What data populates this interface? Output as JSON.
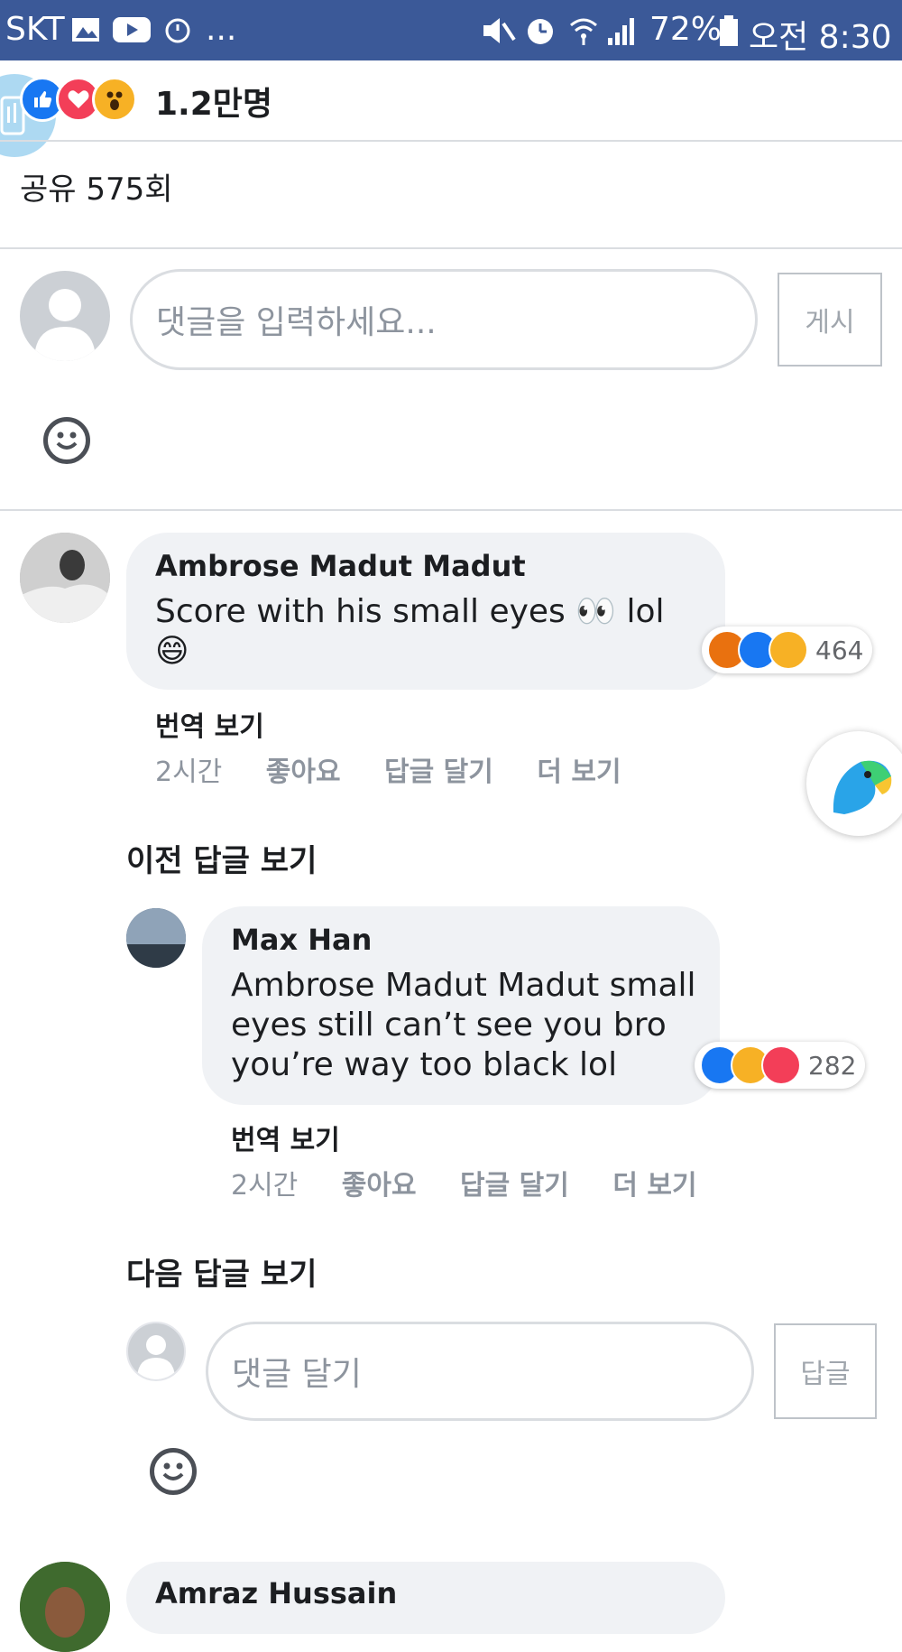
{
  "status_bar": {
    "carrier": "SKT",
    "more": "...",
    "battery": "72%",
    "time": "오전 8:30",
    "icons": [
      "gallery-icon",
      "youtube-icon",
      "alarm-icon",
      "mute-icon",
      "alarm-clock-icon",
      "wifi-icon",
      "signal-icon",
      "battery-icon"
    ]
  },
  "reactions": {
    "types": [
      "like",
      "love",
      "wow"
    ],
    "count": "1.2만명"
  },
  "shares": "공유 575회",
  "composer": {
    "placeholder": "댓글을 입력하세요...",
    "post_label": "게시"
  },
  "comments": [
    {
      "author": "Ambrose Madut Madut",
      "text_line1": "Score with his small eyes 👀 lol",
      "text_line2": "😄",
      "reactions": [
        "angry",
        "like",
        "haha"
      ],
      "reaction_count": "464",
      "translate": "번역 보기",
      "time": "2시간",
      "like": "좋아요",
      "reply": "답글 달기",
      "more": "더 보기"
    }
  ],
  "prev_replies": "이전 답글 보기",
  "reply": {
    "author": "Max Han",
    "text_line1": "Ambrose Madut Madut small",
    "text_line2": "eyes still can’t see you bro",
    "text_line3": "you’re way too black lol",
    "reactions": [
      "like",
      "haha",
      "love"
    ],
    "reaction_count": "282",
    "translate": "번역 보기",
    "time": "2시간",
    "like": "좋아요",
    "reply": "답글 달기",
    "more": "더 보기"
  },
  "next_replies": "다음 답글 보기",
  "reply_composer": {
    "placeholder": "댓글 달기",
    "post_label": "답글"
  },
  "next_comment_author": "Amraz Hussain",
  "colors": {
    "header": "#3b5998",
    "like": "#1877f2",
    "love": "#f33e58",
    "haha": "#f7b125",
    "angry": "#e9710f"
  }
}
